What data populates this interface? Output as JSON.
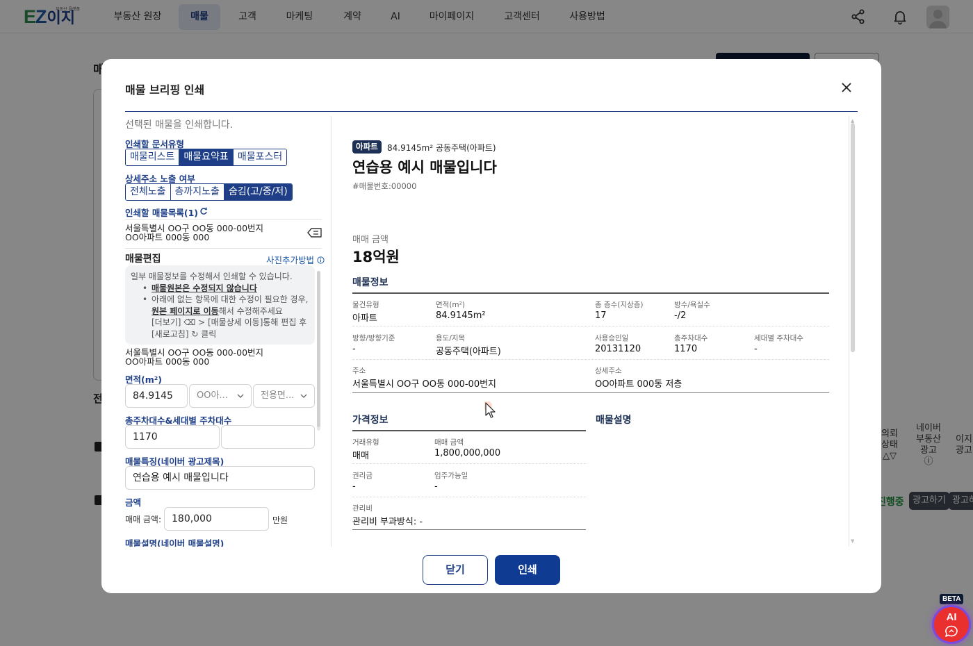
{
  "nav": {
    "logo_text": "EZ",
    "logo_korean": "이지",
    "logo_tagline": "부동산 플랫폼",
    "items": [
      {
        "label": "부동산 원장"
      },
      {
        "label": "매물"
      },
      {
        "label": "고객"
      },
      {
        "label": "마케팅"
      },
      {
        "label": "계약"
      },
      {
        "label": "AI"
      },
      {
        "label": "마이페이지"
      },
      {
        "label": "고객센터"
      },
      {
        "label": "사용방법"
      }
    ],
    "active_item": "매물",
    "icons": [
      "share-icon",
      "bell-icon",
      "user-avatar-icon"
    ]
  },
  "background": {
    "fragment_1": "매",
    "fragment_2": "전",
    "columns": [
      {
        "label": "의뢰\n상태\n△▽"
      },
      {
        "label": "네이버\n부동산\n광고\nⓘ"
      },
      {
        "label": "이지\n광고"
      }
    ],
    "status_text": "진행중",
    "ad_button_1": "광고하기",
    "ad_button_2": "광고하"
  },
  "modal": {
    "title": "매물 브리핑 인쇄",
    "description": "선택된 매물을 인쇄합니다.",
    "doc_type": {
      "label": "인쇄할 문서유형",
      "options": [
        "매물리스트",
        "매물요약표",
        "매물포스터"
      ],
      "selected": "매물요약표"
    },
    "address_exposure": {
      "label": "상세주소 노출 여부",
      "options": [
        "전체노출",
        "층까지노출",
        "숨김(고/중/저)"
      ],
      "selected": "숨김(고/중/저)"
    },
    "print_list": {
      "label": "인쇄할 매물목록(1)",
      "items": [
        {
          "line1": "서울특별시 OO구 OO동 000-00번지",
          "line2": "OO아파트 000동 000"
        }
      ]
    },
    "edit": {
      "title": "매물편집",
      "photo_link": "사진추가방법",
      "info_intro": "일부 매물정보를 수정해서 인쇄할 수 있습니다.",
      "info_bullet_1": "매물원본은 수정되지 않습니다",
      "info_bullet_2_pre": "아래에 없는 항목에 대한 수정이 필요한 경우,",
      "info_bullet_2_link": "원본 페이지로 이동",
      "info_bullet_2_post": "해서 수정해주세요",
      "info_bullet_2_line3": "[더보기]",
      "info_bullet_2_line3b": " > [매물상세 이동]통해 편집 후",
      "info_bullet_2_line4": "[새로고침]",
      "info_bullet_2_line4b": " 클릭",
      "address_line1": "서울특별시 OO구 OO동 000-00번지",
      "address_line2": "OO아파트 000동 000",
      "area_label": "면적(m²)",
      "area_value": "84.9145",
      "area_select_1": "OO아...",
      "area_select_2": "전용면...",
      "parking_label": "총주차대수&세대별 주차대수",
      "parking_total": "1170",
      "parking_per_unit": "",
      "feature_label": "매물특징(네이버 광고제목)",
      "feature_value": "연습용 예시 매물입니다",
      "amount_label": "금액",
      "sale_amount_label": "매매 금액:",
      "sale_amount_value": "180,000",
      "sale_amount_unit": "만원",
      "naver_desc_label": "매물설명(네이버 매물설명)"
    },
    "preview": {
      "badge": "아파트",
      "meta": "84.9145m²  공동주택(아파트)",
      "title": "연습용 예시 매물입니다",
      "number": "#매물번호:00000",
      "price_label": "매매 금액",
      "price_value": "18억원",
      "info_title": "매물정보",
      "info": {
        "type_k": "물건유형",
        "type_v": "아파트",
        "area_k": "면적(m²)",
        "area_v": "84.9145m²",
        "floors_k": "총 층수(지상층)",
        "floors_v": "17",
        "rooms_k": "방수/욕실수",
        "rooms_v": "-/2",
        "direction_k": "방향/방향기준",
        "direction_v": "-",
        "usage_k": "용도/지목",
        "usage_v": "공동주택(아파트)",
        "approval_k": "사용승인일",
        "approval_v": "20131120",
        "parking_k": "총주차대수",
        "parking_v": "1170",
        "unit_parking_k": "세대별 주차대수",
        "unit_parking_v": "-",
        "address_k": "주소",
        "address_v": "서울특별시 OO구 OO동 000-00번지",
        "detail_k": "상세주소",
        "detail_v": "OO아파트 000동 저층"
      },
      "price_info_title": "가격정보",
      "desc_title": "매물설명",
      "price_info": {
        "deal_k": "거래유형",
        "deal_v": "매매",
        "amount_k": "매매 금액",
        "amount_v": "1,800,000,000",
        "premium_k": "권리금",
        "premium_v": "-",
        "move_in_k": "입주가능일",
        "move_in_v": "-",
        "mgmt_k": "관리비",
        "mgmt_v": "관리비 부과방식: -"
      }
    },
    "close_label": "닫기",
    "print_label": "인쇄"
  },
  "ai_button": {
    "beta": "BETA",
    "label": "AI"
  },
  "colors": {
    "brand_navy": "#1e3f88",
    "primary_button": "#0f3b93",
    "logo_green": "#2e8a4c",
    "ai_red": "#ea2f2f"
  }
}
